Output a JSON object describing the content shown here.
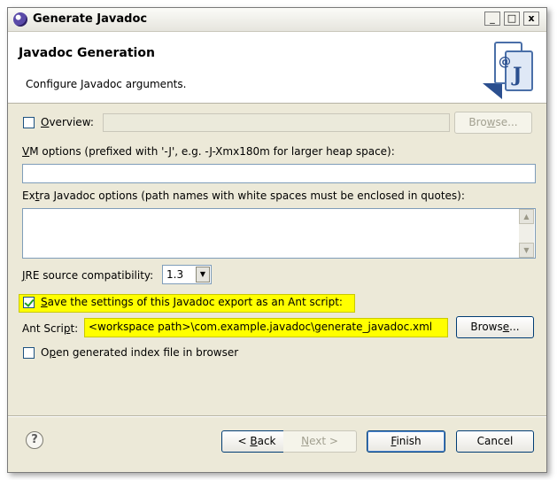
{
  "window": {
    "title": "Generate Javadoc",
    "controls": [
      "_",
      "□",
      "x"
    ]
  },
  "header": {
    "title": "Javadoc Generation",
    "description": "Configure Javadoc arguments."
  },
  "overview": {
    "label_accel": "O",
    "label_rest": "verview:",
    "checked": false,
    "value": "",
    "browse_accel": "w",
    "browse_pre": "Bro",
    "browse_post": "se..."
  },
  "vm_options": {
    "label_accel": "V",
    "label_rest": "M options (prefixed with '-J', e.g. -J-Xmx180m for larger heap space):",
    "value": ""
  },
  "extra_options": {
    "label_pre": "Ex",
    "label_accel": "t",
    "label_rest": "ra Javadoc options (path names with white spaces must be enclosed in quotes):",
    "value": ""
  },
  "jre": {
    "label_accel": "J",
    "label_rest": "RE source compatibility:",
    "value": "1.3"
  },
  "save_ant": {
    "checked": true,
    "label_accel": "S",
    "label_rest": "ave the settings of this Javadoc export as an Ant script:"
  },
  "ant_script": {
    "label_pre": "Ant Scri",
    "label_accel": "p",
    "label_rest": "t:",
    "value": "<workspace path>\\com.example.javadoc\\generate_javadoc.xml",
    "browse_pre": "Brows",
    "browse_accel": "e",
    "browse_post": "..."
  },
  "open_index": {
    "checked": false,
    "label_pre": "O",
    "label_accel": "p",
    "label_rest": "en generated index file in browser"
  },
  "buttons": {
    "help": "?",
    "back_pre": "< ",
    "back_accel": "B",
    "back_post": "ack",
    "next_accel": "N",
    "next_post": "ext >",
    "finish_accel": "F",
    "finish_post": "inish",
    "cancel": "Cancel"
  },
  "colors": {
    "highlight": "#ffff00",
    "checkmark": "#21a121"
  }
}
